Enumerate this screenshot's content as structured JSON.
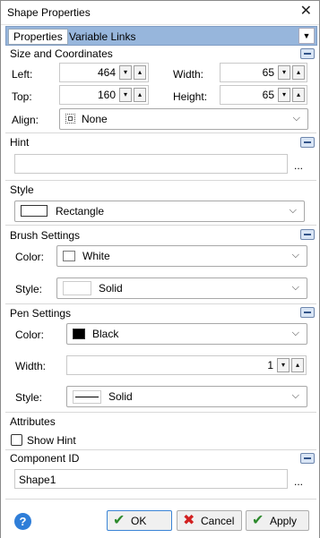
{
  "window": {
    "title": "Shape Properties",
    "close_glyph": "✕"
  },
  "tabs": {
    "active": "Properties",
    "other": "Variable Links",
    "dropdown_glyph": "▼"
  },
  "size_coords": {
    "header": "Size and Coordinates",
    "left_label": "Left:",
    "left_value": "464",
    "width_label": "Width:",
    "width_value": "65",
    "top_label": "Top:",
    "top_value": "160",
    "height_label": "Height:",
    "height_value": "65",
    "align_label": "Align:",
    "align_value": "None"
  },
  "hint": {
    "header": "Hint",
    "value": "",
    "ellipsis": "..."
  },
  "style": {
    "header": "Style",
    "value": "Rectangle"
  },
  "brush": {
    "header": "Brush Settings",
    "color_label": "Color:",
    "color_value": "White",
    "color_hex": "#ffffff",
    "style_label": "Style:",
    "style_value": "Solid"
  },
  "pen": {
    "header": "Pen Settings",
    "color_label": "Color:",
    "color_value": "Black",
    "color_hex": "#000000",
    "width_label": "Width:",
    "width_value": "1",
    "style_label": "Style:",
    "style_value": "Solid"
  },
  "attributes": {
    "header": "Attributes",
    "show_hint_label": "Show Hint",
    "show_hint_checked": false
  },
  "component_id": {
    "header": "Component ID",
    "value": "Shape1",
    "ellipsis": "..."
  },
  "buttons": {
    "ok": "OK",
    "cancel": "Cancel",
    "apply": "Apply",
    "help_glyph": "?"
  },
  "icons": {
    "spin_down": "▾",
    "spin_up": "▴",
    "chevron": "⌵"
  },
  "colors": {
    "tab_bar": "#97b6dc",
    "help": "#2f7ed8",
    "ok_check": "#2d8a2d",
    "cancel_x": "#d22020"
  }
}
